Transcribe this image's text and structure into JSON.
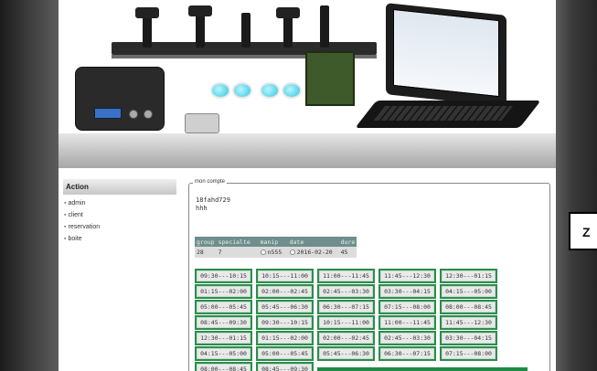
{
  "sidebar": {
    "title": "Action",
    "items": [
      {
        "label": "admin"
      },
      {
        "label": "client"
      },
      {
        "label": "reservation"
      },
      {
        "label": "boite"
      }
    ]
  },
  "account": {
    "legend": "mon compte",
    "line1": "18fahd729",
    "line2": "hhh",
    "table": {
      "headers": [
        "group",
        "specialte",
        "manip",
        "date",
        "dure"
      ],
      "row": {
        "group": "28",
        "specialte": "7",
        "manip": "n555",
        "date": "2016-02-20",
        "dure": "45"
      }
    }
  },
  "slots": [
    "09:30---10:15",
    "10:15---11:00",
    "11:00---11:45",
    "11:45---12:30",
    "12:30---01:15",
    "01:15---02:00",
    "02:00---02:45",
    "02:45---03:30",
    "03:30---04:15",
    "04:15---05:00",
    "05:00---05:45",
    "05:45---06:30",
    "06:30---07:15",
    "07:15---08:00",
    "08:00---08:45",
    "08:45---09:30",
    "09:30---10:15",
    "10:15---11:00",
    "11:00---11:45",
    "11:45---12:30",
    "12:30---01:15",
    "01:15---02:00",
    "02:00---02:45",
    "02:45---03:30",
    "03:30---04:15",
    "04:15---05:00",
    "05:00---05:45",
    "05:45---06:30",
    "06:30---07:15",
    "07:15---08:00",
    "08:00---08:45",
    "08:45---09:30"
  ],
  "zoom": {
    "label": "Z"
  },
  "colors": {
    "slot_border": "#2f8b4e",
    "table_header": "#6f8e8c",
    "accent_green": "#1e8a46"
  }
}
